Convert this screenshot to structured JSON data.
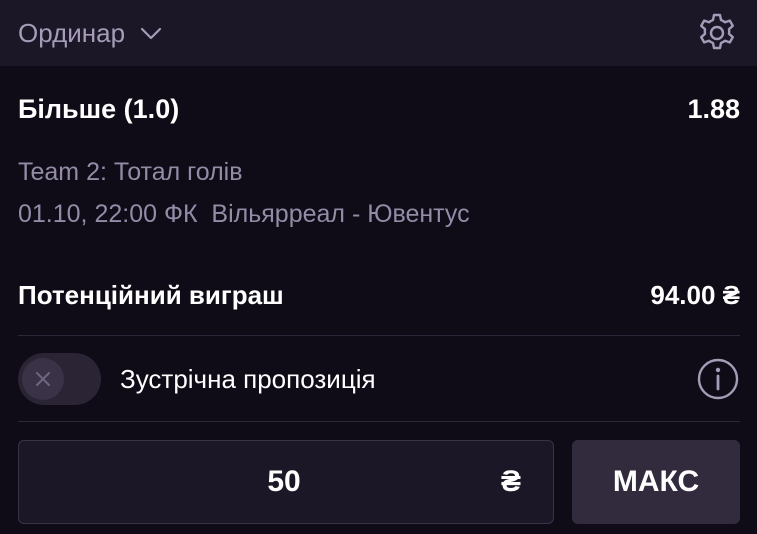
{
  "header": {
    "bet_type": "Ординар",
    "icons": {
      "dropdown": "chevron-down-icon",
      "settings": "gear-icon"
    }
  },
  "selection": {
    "name": "Більше (1.0)",
    "odds": "1.88",
    "market": "Team 2: Тотал голів",
    "event": "01.10, 22:00 ФК  Вільярреал - Ювентус"
  },
  "potential_win": {
    "label": "Потенційний виграш",
    "value": "94.00 ₴"
  },
  "counter_offer": {
    "label": "Зустрічна пропозиція",
    "enabled": false,
    "icons": {
      "toggle": "close-icon",
      "info": "info-icon"
    }
  },
  "stake": {
    "value": "50",
    "currency": "₴",
    "max_label": "МАКС"
  },
  "colors": {
    "background": "#0f0b17",
    "header_bg": "#1c1727",
    "muted_text": "#948ba7",
    "button_bg": "#322b3e"
  }
}
